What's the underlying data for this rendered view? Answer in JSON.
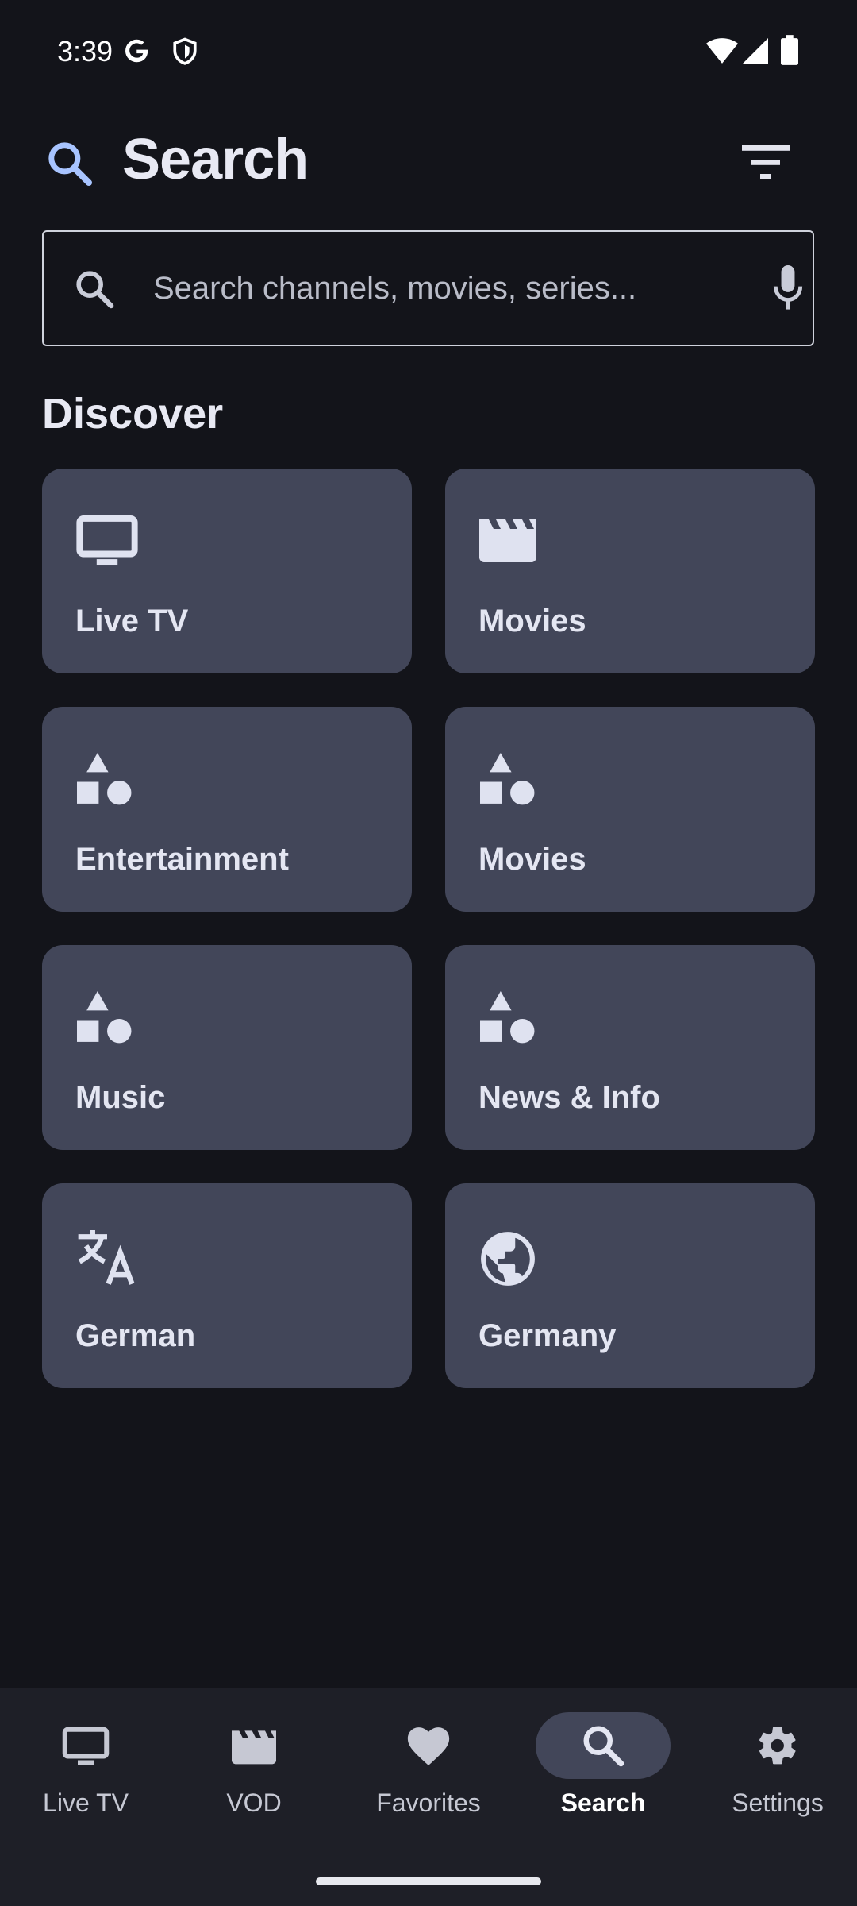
{
  "status_bar": {
    "time": "3:39",
    "icons": [
      "google-icon",
      "shield-icon",
      "wifi-icon",
      "signal-icon",
      "battery-icon"
    ]
  },
  "header": {
    "title": "Search",
    "icon": "search-icon",
    "filter_icon": "filter-icon"
  },
  "search": {
    "placeholder": "Search channels, movies, series...",
    "value": "",
    "mic_icon": "mic-icon"
  },
  "discover": {
    "title": "Discover",
    "cards": [
      {
        "label": "Live TV",
        "icon": "tv-icon"
      },
      {
        "label": "Movies",
        "icon": "clapperboard-icon"
      },
      {
        "label": "Entertainment",
        "icon": "category-icon"
      },
      {
        "label": "Movies",
        "icon": "category-icon"
      },
      {
        "label": "Music",
        "icon": "category-icon"
      },
      {
        "label": "News & Info",
        "icon": "category-icon"
      },
      {
        "label": "German",
        "icon": "translate-icon"
      },
      {
        "label": "Germany",
        "icon": "globe-icon"
      }
    ]
  },
  "bottom_nav": {
    "items": [
      {
        "label": "Live TV",
        "icon": "tv-icon",
        "active": false
      },
      {
        "label": "VOD",
        "icon": "clapperboard-icon",
        "active": false
      },
      {
        "label": "Favorites",
        "icon": "heart-icon",
        "active": false
      },
      {
        "label": "Search",
        "icon": "search-icon",
        "active": true
      },
      {
        "label": "Settings",
        "icon": "gear-icon",
        "active": false
      }
    ]
  },
  "colors": {
    "background": "#13141a",
    "card": "#424659",
    "accent": "#a8c4ff",
    "nav_background": "#1e1f27"
  }
}
